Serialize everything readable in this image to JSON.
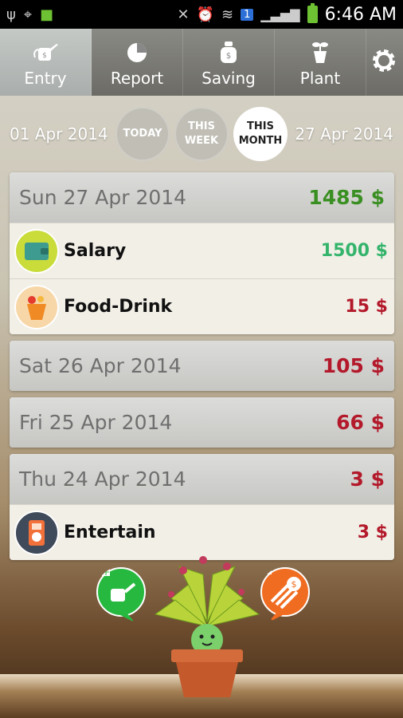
{
  "status": {
    "time": "6:46 AM",
    "badge": "1"
  },
  "tabs": [
    {
      "label": "Entry",
      "icon": "watering-can-icon"
    },
    {
      "label": "Report",
      "icon": "pie-chart-icon"
    },
    {
      "label": "Saving",
      "icon": "money-bag-icon"
    },
    {
      "label": "Plant",
      "icon": "sprout-pot-icon"
    }
  ],
  "range": {
    "start": "01 Apr 2014",
    "end": "27 Apr 2014",
    "today": "TODAY",
    "week_l1": "THIS",
    "week_l2": "WEEK",
    "month_l1": "THIS",
    "month_l2": "MONTH"
  },
  "days": [
    {
      "date": "Sun 27 Apr 2014",
      "total": "1485 $",
      "items": [
        {
          "name": "Salary",
          "amount": "1500 $"
        },
        {
          "name": "Food-Drink",
          "amount": "15 $"
        }
      ]
    },
    {
      "date": "Sat 26 Apr 2014",
      "total": "105 $"
    },
    {
      "date": "Fri 25 Apr 2014",
      "total": "66 $"
    },
    {
      "date": "Thu 24 Apr 2014",
      "total": "3 $",
      "items": [
        {
          "name": "Entertain",
          "amount": "3 $"
        }
      ]
    }
  ],
  "colors": {
    "income": "#34b46b",
    "expense": "#b3192a",
    "positive_total": "#3a8f22"
  }
}
